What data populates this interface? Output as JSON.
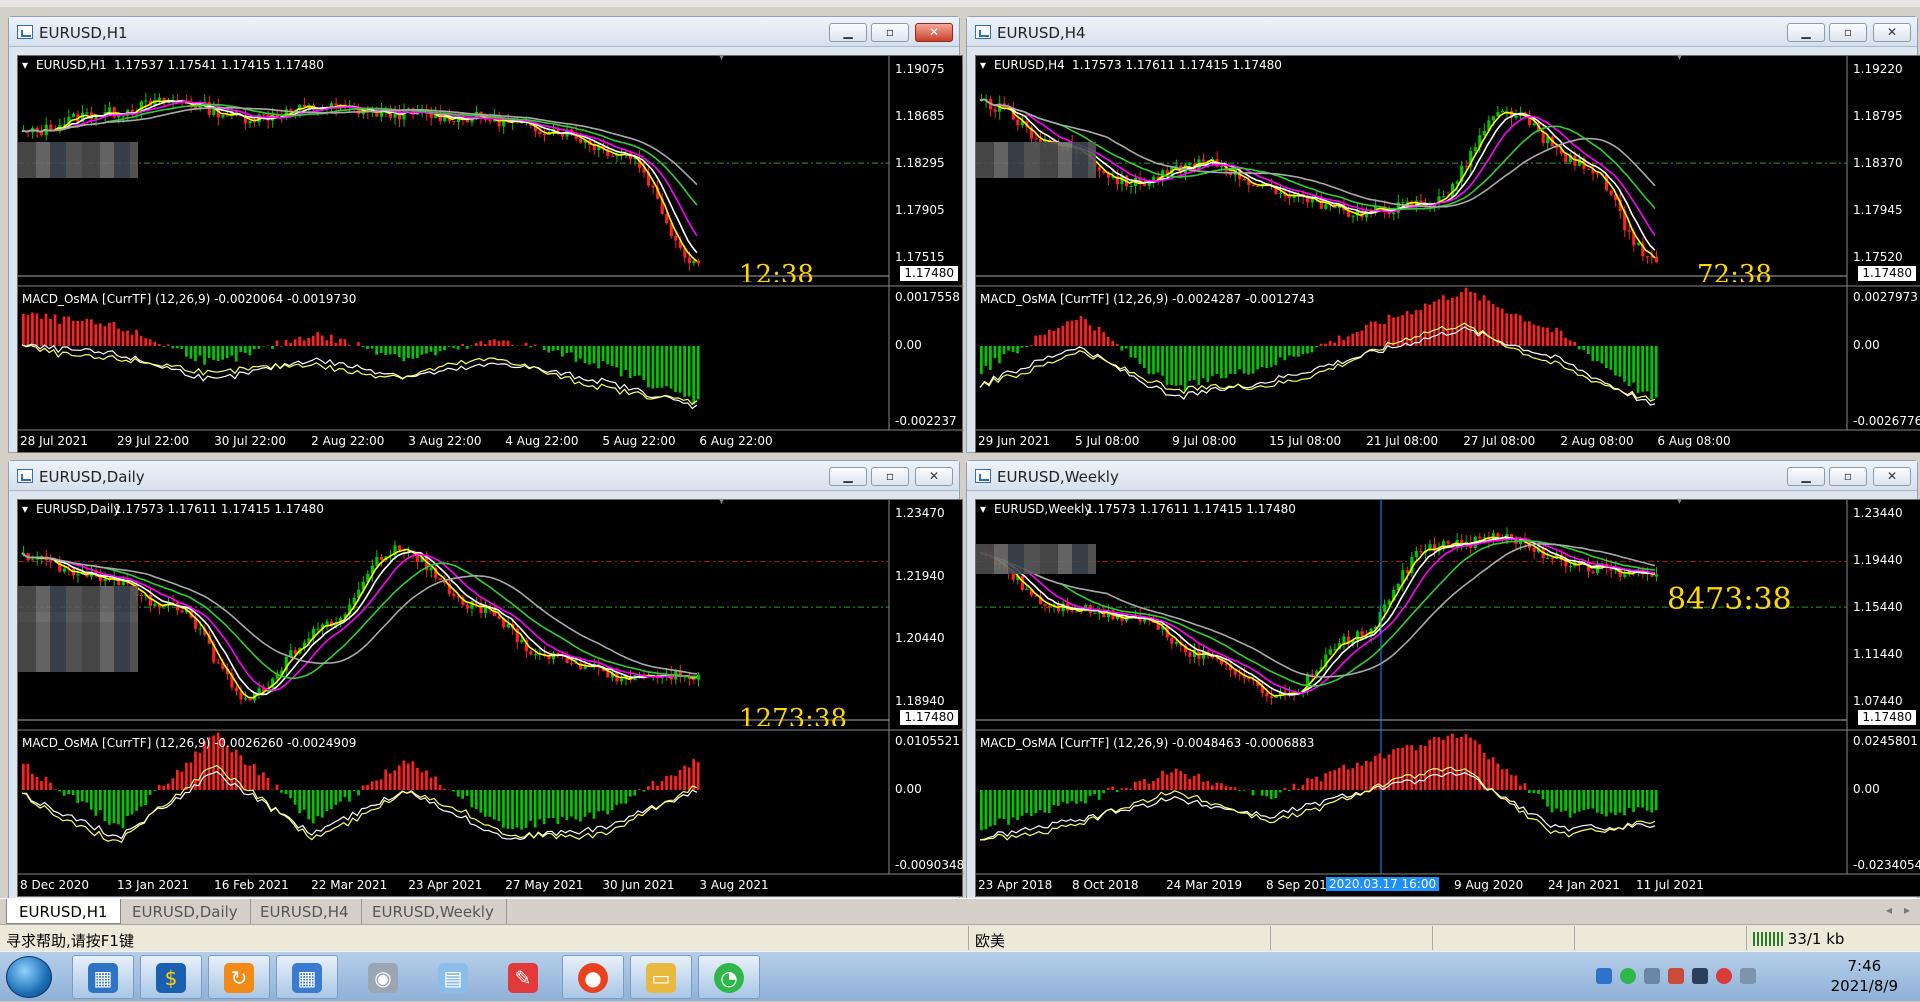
{
  "windows": [
    {
      "title": "EURUSD,H1",
      "info_symbol": "EURUSD,H1",
      "info_prices": "1.17537 1.17541 1.17415 1.17480",
      "price_ticks": [
        "1.19075",
        "1.18685",
        "1.18295",
        "1.17905",
        "1.17515"
      ],
      "current_price": "1.17480",
      "timer": "12:38",
      "macd_label": "MACD_OsMA [CurrTF] (12,26,9) -0.0020064 -0.0019730",
      "macd_ticks": [
        "0.0017558",
        "0.00",
        "-0.002237"
      ],
      "time_ticks": [
        "28 Jul 2021",
        "29 Jul 22:00",
        "30 Jul 22:00",
        "2 Aug 22:00",
        "3 Aug 22:00",
        "4 Aug 22:00",
        "5 Aug 22:00",
        "6 Aug 22:00"
      ],
      "close_active": true
    },
    {
      "title": "EURUSD,H4",
      "info_symbol": "EURUSD,H4",
      "info_prices": "1.17573 1.17611 1.17415 1.17480",
      "price_ticks": [
        "1.19220",
        "1.18795",
        "1.18370",
        "1.17945",
        "1.17520"
      ],
      "current_price": "1.17480",
      "timer": "72:38",
      "macd_label": "MACD_OsMA [CurrTF] (12,26,9) -0.0024287 -0.0012743",
      "macd_ticks": [
        "0.0027973",
        "0.00",
        "-0.0026776"
      ],
      "time_ticks": [
        "29 Jun 2021",
        "5 Jul 08:00",
        "9 Jul 08:00",
        "15 Jul 08:00",
        "21 Jul 08:00",
        "27 Jul 08:00",
        "2 Aug 08:00",
        "6 Aug 08:00"
      ],
      "close_active": false
    },
    {
      "title": "EURUSD,Daily",
      "info_symbol": "EURUSD,Daily",
      "info_prices": "1.17573 1.17611 1.17415 1.17480",
      "price_ticks": [
        "1.23470",
        "1.21940",
        "1.20440",
        "1.18940"
      ],
      "current_price": "1.17480",
      "timer": "1273:38",
      "macd_label": "MACD_OsMA [CurrTF] (12,26,9) -0.0026260 -0.0024909",
      "macd_ticks": [
        "0.0105521",
        "0.00",
        "-0.0090348"
      ],
      "time_ticks": [
        "8 Dec 2020",
        "13 Jan 2021",
        "16 Feb 2021",
        "22 Mar 2021",
        "23 Apr 2021",
        "27 May 2021",
        "30 Jun 2021",
        "3 Aug 2021"
      ],
      "close_active": false
    },
    {
      "title": "EURUSD,Weekly",
      "info_symbol": "EURUSD,Weekly",
      "info_prices": "1.17573 1.17611 1.17415 1.17480",
      "price_ticks": [
        "1.23440",
        "1.19440",
        "1.15440",
        "1.11440",
        "1.07440"
      ],
      "current_price": "1.17480",
      "timer": "8473:38",
      "macd_label": "MACD_OsMA [CurrTF] (12,26,9) -0.0048463 -0.0006883",
      "macd_ticks": [
        "0.0245801",
        "0.00",
        "-0.0234054"
      ],
      "time_ticks": [
        "23 Apr 2018",
        "8 Oct 2018",
        "24 Mar 2019",
        "8 Sep 2019",
        "9 Aug 2020",
        "24 Jan 2021",
        "11 Jul 2021"
      ],
      "crosshair_label": "2020.03.17 16:00",
      "close_active": false
    }
  ],
  "tabs": [
    "EURUSD,H1",
    "EURUSD,Daily",
    "EURUSD,H4",
    "EURUSD,Weekly"
  ],
  "status": {
    "help": "寻求帮助,请按F1键",
    "profile": "欧美",
    "traffic": "33/1 kb"
  },
  "taskbar": {
    "time": "7:46",
    "date": "2021/8/9"
  },
  "colors": {
    "bull": "#00c800",
    "bear": "#ff2020",
    "ma_yellow": "#ffff00",
    "ma_magenta": "#ff00ff",
    "ma_green": "#32cd32",
    "ma_gray": "#a9a9a9",
    "ma_white": "#ffffff"
  }
}
